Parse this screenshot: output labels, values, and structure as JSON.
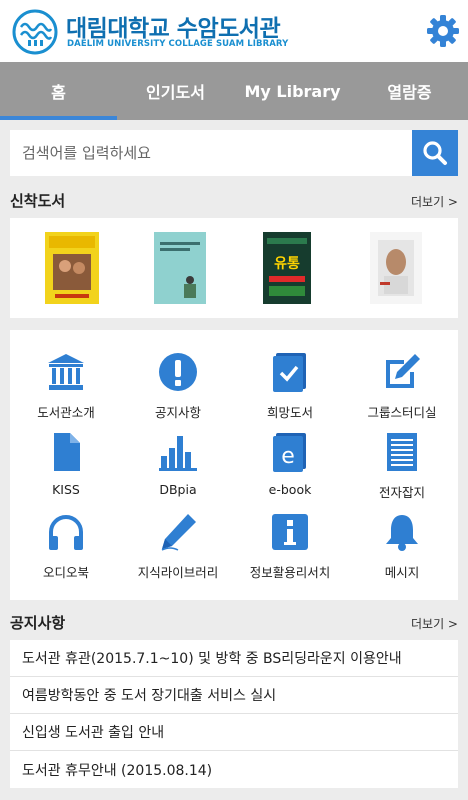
{
  "header": {
    "title_ko": "대림대학교 수암도서관",
    "title_en": "DAELIM UNIVERSITY COLLAGE SUAM LIBRARY",
    "logo_icon": "library-logo-icon",
    "settings_icon": "gear-icon"
  },
  "tabs": [
    {
      "label": "홈",
      "active": true
    },
    {
      "label": "인기도서",
      "active": false
    },
    {
      "label": "My Library",
      "active": false
    },
    {
      "label": "열람증",
      "active": false
    }
  ],
  "search": {
    "placeholder": "검색어를 입력하세요",
    "button_icon": "search-icon"
  },
  "new_books": {
    "title": "신착도서",
    "more": "더보기 >"
  },
  "menu": {
    "items": [
      {
        "label": "도서관소개",
        "icon": "bank-icon"
      },
      {
        "label": "공지사항",
        "icon": "exclamation-icon"
      },
      {
        "label": "희망도서",
        "icon": "book-check-icon"
      },
      {
        "label": "그룹스터디실",
        "icon": "edit-icon"
      },
      {
        "label": "KISS",
        "icon": "file-icon"
      },
      {
        "label": "DBpia",
        "icon": "bar-chart-icon"
      },
      {
        "label": "e-book",
        "icon": "ebook-icon"
      },
      {
        "label": "전자잡지",
        "icon": "document-lines-icon"
      },
      {
        "label": "오디오북",
        "icon": "headphones-icon"
      },
      {
        "label": "지식라이브러리",
        "icon": "pen-icon"
      },
      {
        "label": "정보활용리서치",
        "icon": "info-icon"
      },
      {
        "label": "메시지",
        "icon": "bell-icon"
      }
    ]
  },
  "notices": {
    "title": "공지사항",
    "more": "더보기 >",
    "items": [
      "도서관 휴관(2015.7.1~10) 및 방학 중 BS리딩라운지 이용안내",
      "여름방학동안 중 도서 장기대출 서비스 실시",
      "신입생 도서관 출입 안내",
      "도서관 휴무안내 (2015.08.14)"
    ]
  },
  "colors": {
    "brand": "#0f6fb0",
    "accent": "#3483d6",
    "tab_bar": "#999999",
    "icon_blue": "#2f7fd2"
  }
}
